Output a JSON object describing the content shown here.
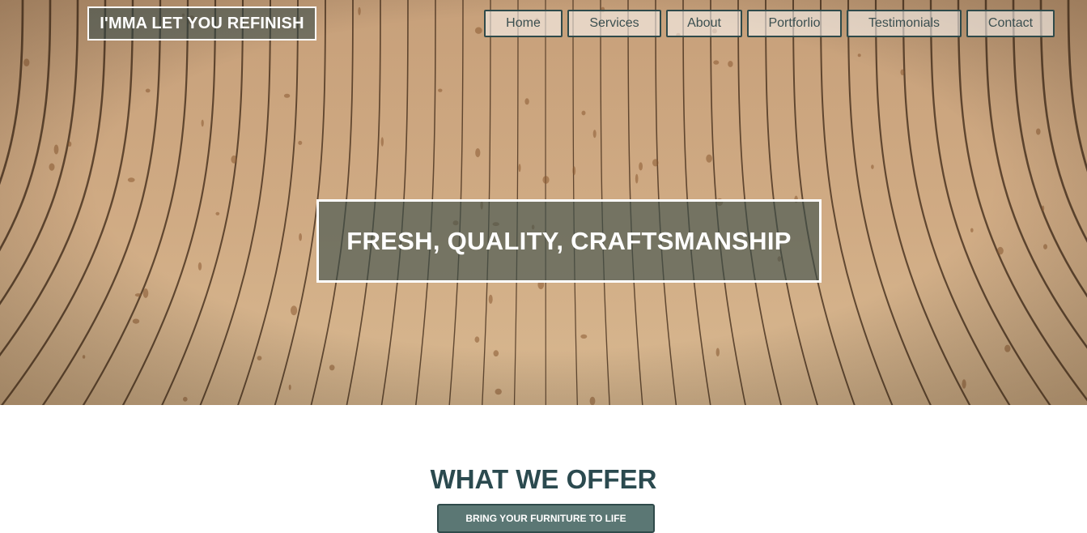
{
  "header": {
    "logo_text": "I'MMA LET YOU REFINISH"
  },
  "nav": {
    "items": [
      {
        "label": "Home"
      },
      {
        "label": "Services"
      },
      {
        "label": "About"
      },
      {
        "label": "Portforlio"
      },
      {
        "label": "Testimonials"
      },
      {
        "label": "Contact"
      }
    ]
  },
  "hero": {
    "tagline": "FRESH, QUALITY, CRAFTSMANSHIP",
    "background_image": "curved-wood-plank-floor"
  },
  "offer": {
    "title": "WHAT WE OFFER",
    "cta_label": "BRING YOUR FURNITURE TO LIFE"
  },
  "colors": {
    "accent": "#2b4a4f",
    "button_fill": "#5b7774",
    "wood": "#c9a57f"
  }
}
